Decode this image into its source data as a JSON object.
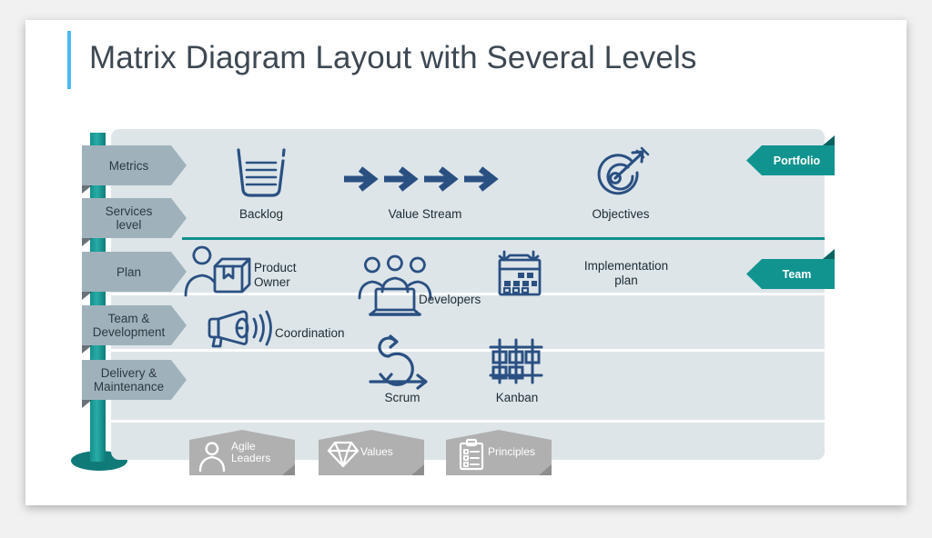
{
  "slide": {
    "title": "Matrix Diagram Layout with Several Levels",
    "accent_color": "#4bb9f0",
    "panel_color": "#dde5e9",
    "teal": "#119490",
    "icon_navy": "#2a5082",
    "tab_gray": "#9fb2bc",
    "tag_gray": "#b0b0b0"
  },
  "left_tabs": [
    {
      "label": "Metrics"
    },
    {
      "label": "Services\nlevel"
    },
    {
      "label": "Plan"
    },
    {
      "label": "Team &\nDevelopment"
    },
    {
      "label": "Delivery &\nMaintenance"
    }
  ],
  "right_badges": [
    {
      "label": "Portfolio"
    },
    {
      "label": "Team"
    }
  ],
  "nodes": [
    {
      "label": "Backlog",
      "icon": "backlog-basket-icon"
    },
    {
      "label": "Value Stream",
      "icon": "four-arrows-icon"
    },
    {
      "label": "Objectives",
      "icon": "target-arrow-icon"
    },
    {
      "label": "Product\nOwner",
      "icon": "person-box-icon"
    },
    {
      "label": "Developers",
      "icon": "team-laptop-icon"
    },
    {
      "label": "Implementation\nplan",
      "icon": "calendar-icon"
    },
    {
      "label": "Coordination",
      "icon": "megaphone-icon"
    },
    {
      "label": "Scrum",
      "icon": "sprint-loop-icon"
    },
    {
      "label": "Kanban",
      "icon": "kanban-board-icon"
    }
  ],
  "bottom_tags": [
    {
      "label": "Agile\nLeaders",
      "icon": "person-icon"
    },
    {
      "label": "Values",
      "icon": "diamond-icon"
    },
    {
      "label": "Principles",
      "icon": "clipboard-icon"
    }
  ]
}
